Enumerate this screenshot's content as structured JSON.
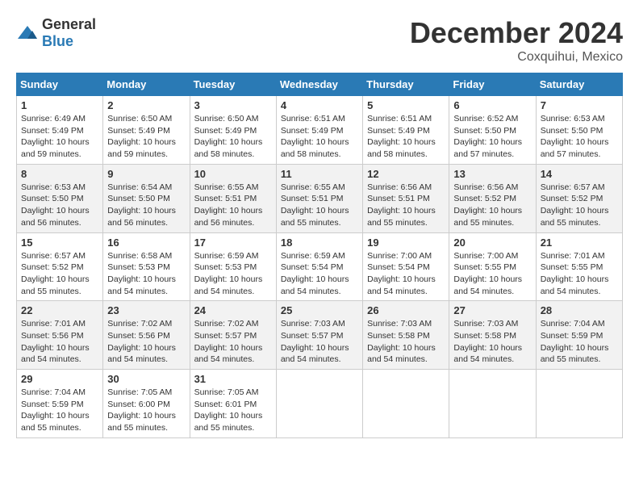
{
  "logo": {
    "general": "General",
    "blue": "Blue"
  },
  "title": {
    "month": "December 2024",
    "location": "Coxquihui, Mexico"
  },
  "headers": [
    "Sunday",
    "Monday",
    "Tuesday",
    "Wednesday",
    "Thursday",
    "Friday",
    "Saturday"
  ],
  "weeks": [
    [
      {
        "day": "1",
        "sunrise": "6:49 AM",
        "sunset": "5:49 PM",
        "daylight": "10 hours and 59 minutes."
      },
      {
        "day": "2",
        "sunrise": "6:50 AM",
        "sunset": "5:49 PM",
        "daylight": "10 hours and 59 minutes."
      },
      {
        "day": "3",
        "sunrise": "6:50 AM",
        "sunset": "5:49 PM",
        "daylight": "10 hours and 58 minutes."
      },
      {
        "day": "4",
        "sunrise": "6:51 AM",
        "sunset": "5:49 PM",
        "daylight": "10 hours and 58 minutes."
      },
      {
        "day": "5",
        "sunrise": "6:51 AM",
        "sunset": "5:49 PM",
        "daylight": "10 hours and 58 minutes."
      },
      {
        "day": "6",
        "sunrise": "6:52 AM",
        "sunset": "5:50 PM",
        "daylight": "10 hours and 57 minutes."
      },
      {
        "day": "7",
        "sunrise": "6:53 AM",
        "sunset": "5:50 PM",
        "daylight": "10 hours and 57 minutes."
      }
    ],
    [
      {
        "day": "8",
        "sunrise": "6:53 AM",
        "sunset": "5:50 PM",
        "daylight": "10 hours and 56 minutes."
      },
      {
        "day": "9",
        "sunrise": "6:54 AM",
        "sunset": "5:50 PM",
        "daylight": "10 hours and 56 minutes."
      },
      {
        "day": "10",
        "sunrise": "6:55 AM",
        "sunset": "5:51 PM",
        "daylight": "10 hours and 56 minutes."
      },
      {
        "day": "11",
        "sunrise": "6:55 AM",
        "sunset": "5:51 PM",
        "daylight": "10 hours and 55 minutes."
      },
      {
        "day": "12",
        "sunrise": "6:56 AM",
        "sunset": "5:51 PM",
        "daylight": "10 hours and 55 minutes."
      },
      {
        "day": "13",
        "sunrise": "6:56 AM",
        "sunset": "5:52 PM",
        "daylight": "10 hours and 55 minutes."
      },
      {
        "day": "14",
        "sunrise": "6:57 AM",
        "sunset": "5:52 PM",
        "daylight": "10 hours and 55 minutes."
      }
    ],
    [
      {
        "day": "15",
        "sunrise": "6:57 AM",
        "sunset": "5:52 PM",
        "daylight": "10 hours and 55 minutes."
      },
      {
        "day": "16",
        "sunrise": "6:58 AM",
        "sunset": "5:53 PM",
        "daylight": "10 hours and 54 minutes."
      },
      {
        "day": "17",
        "sunrise": "6:59 AM",
        "sunset": "5:53 PM",
        "daylight": "10 hours and 54 minutes."
      },
      {
        "day": "18",
        "sunrise": "6:59 AM",
        "sunset": "5:54 PM",
        "daylight": "10 hours and 54 minutes."
      },
      {
        "day": "19",
        "sunrise": "7:00 AM",
        "sunset": "5:54 PM",
        "daylight": "10 hours and 54 minutes."
      },
      {
        "day": "20",
        "sunrise": "7:00 AM",
        "sunset": "5:55 PM",
        "daylight": "10 hours and 54 minutes."
      },
      {
        "day": "21",
        "sunrise": "7:01 AM",
        "sunset": "5:55 PM",
        "daylight": "10 hours and 54 minutes."
      }
    ],
    [
      {
        "day": "22",
        "sunrise": "7:01 AM",
        "sunset": "5:56 PM",
        "daylight": "10 hours and 54 minutes."
      },
      {
        "day": "23",
        "sunrise": "7:02 AM",
        "sunset": "5:56 PM",
        "daylight": "10 hours and 54 minutes."
      },
      {
        "day": "24",
        "sunrise": "7:02 AM",
        "sunset": "5:57 PM",
        "daylight": "10 hours and 54 minutes."
      },
      {
        "day": "25",
        "sunrise": "7:03 AM",
        "sunset": "5:57 PM",
        "daylight": "10 hours and 54 minutes."
      },
      {
        "day": "26",
        "sunrise": "7:03 AM",
        "sunset": "5:58 PM",
        "daylight": "10 hours and 54 minutes."
      },
      {
        "day": "27",
        "sunrise": "7:03 AM",
        "sunset": "5:58 PM",
        "daylight": "10 hours and 54 minutes."
      },
      {
        "day": "28",
        "sunrise": "7:04 AM",
        "sunset": "5:59 PM",
        "daylight": "10 hours and 55 minutes."
      }
    ],
    [
      {
        "day": "29",
        "sunrise": "7:04 AM",
        "sunset": "5:59 PM",
        "daylight": "10 hours and 55 minutes."
      },
      {
        "day": "30",
        "sunrise": "7:05 AM",
        "sunset": "6:00 PM",
        "daylight": "10 hours and 55 minutes."
      },
      {
        "day": "31",
        "sunrise": "7:05 AM",
        "sunset": "6:01 PM",
        "daylight": "10 hours and 55 minutes."
      },
      null,
      null,
      null,
      null
    ]
  ]
}
